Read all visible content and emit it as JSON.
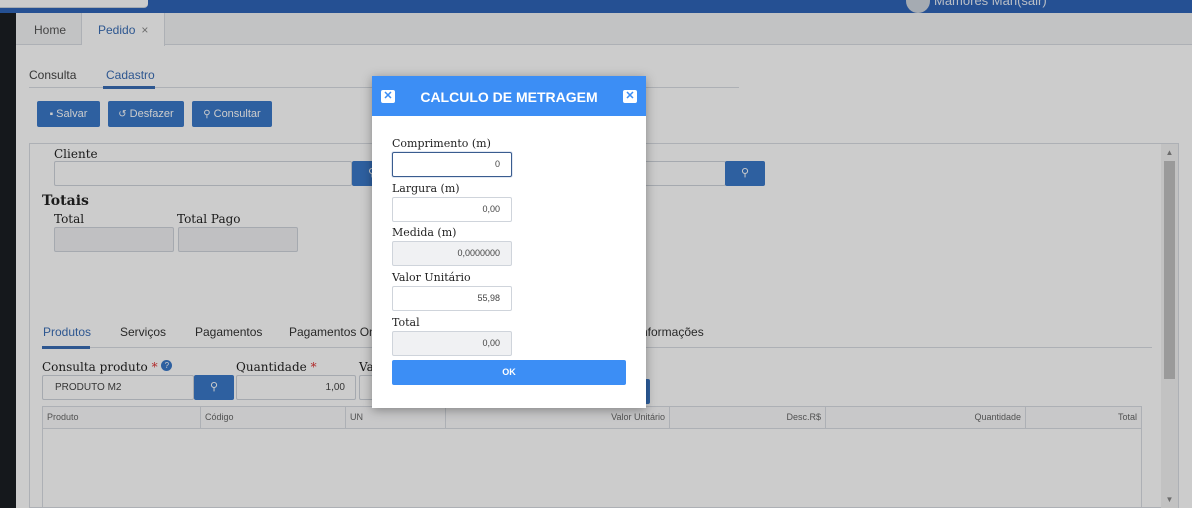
{
  "header": {
    "user_name": "Mamores Mah(sair)"
  },
  "tabs": {
    "home": "Home",
    "pedido": "Pedido",
    "close": "×"
  },
  "subtabs": {
    "consulta": "Consulta",
    "cadastro": "Cadastro"
  },
  "toolbar": {
    "save_label": "Salvar",
    "undo_label": "Desfazer",
    "search_label": "Consultar"
  },
  "form": {
    "cliente_label": "Cliente",
    "totais_heading": "Totais",
    "total_label": "Total",
    "total_pago_label": "Total Pago"
  },
  "product_tabs": [
    "Produtos",
    "Serviços",
    "Pagamentos",
    "Pagamentos On",
    "nformações"
  ],
  "product_form": {
    "consulta_label": "Consulta produto",
    "required_mark": "*",
    "help_mark": "?",
    "produto_value": "PRODUTO M2",
    "quantidade_label": "Quantidade",
    "quantidade_value": "1,00",
    "valor_label_partial": "Va"
  },
  "grid": {
    "columns": [
      "Produto",
      "Código",
      "UN",
      "Valor Unitário",
      "Desc.R$",
      "Quantidade",
      "Total"
    ]
  },
  "modal": {
    "title": "CALCULO DE METRAGEM",
    "fields": {
      "comprimento_label": "Comprimento (m)",
      "comprimento_value": "0",
      "largura_label": "Largura (m)",
      "largura_value": "0,00",
      "medida_label": "Medida (m)",
      "medida_value": "0,0000000",
      "valor_unitario_label": "Valor Unitário",
      "valor_unitario_value": "55,98",
      "total_label": "Total",
      "total_value": "0,00"
    },
    "ok_label": "OK"
  },
  "colors": {
    "primary": "#3a78c8",
    "modal_header": "#3c8ef5",
    "topbar": "#2f64b8"
  }
}
